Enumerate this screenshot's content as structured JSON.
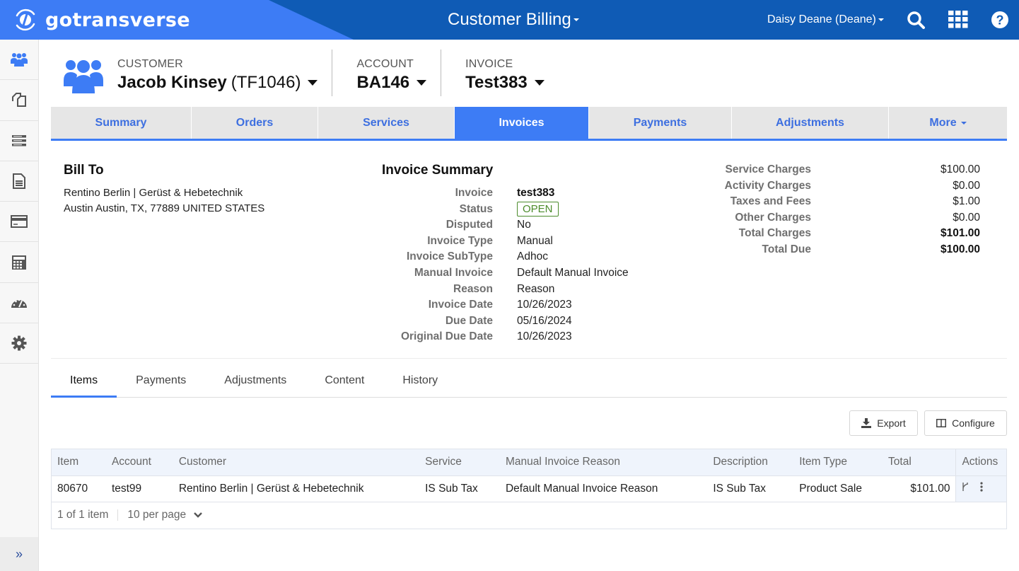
{
  "topbar": {
    "brand": "gotransverse",
    "app_title": "Customer Billing",
    "user": "Daisy Deane (Deane)",
    "icons": [
      "search-icon",
      "apps-grid-icon",
      "help-icon"
    ]
  },
  "sidebar": {
    "items": [
      {
        "name": "customers",
        "icon": "users-icon",
        "active": true
      },
      {
        "name": "documents",
        "icon": "copy-icon"
      },
      {
        "name": "services",
        "icon": "server-list-icon"
      },
      {
        "name": "invoices",
        "icon": "file-text-icon"
      },
      {
        "name": "payments",
        "icon": "credit-card-icon"
      },
      {
        "name": "calculator",
        "icon": "calculator-icon"
      },
      {
        "name": "dashboard",
        "icon": "gauge-icon"
      },
      {
        "name": "settings",
        "icon": "gear-icon"
      }
    ],
    "expand_icon": "»"
  },
  "context": {
    "customer_label": "CUSTOMER",
    "customer_name": "Jacob Kinsey",
    "customer_id": "(TF1046)",
    "account_label": "ACCOUNT",
    "account_value": "BA146",
    "invoice_label": "INVOICE",
    "invoice_value": "Test383"
  },
  "main_tabs": [
    {
      "label": "Summary"
    },
    {
      "label": "Orders"
    },
    {
      "label": "Services"
    },
    {
      "label": "Invoices",
      "active": true
    },
    {
      "label": "Payments"
    },
    {
      "label": "Adjustments"
    },
    {
      "label": "More"
    }
  ],
  "bill_to": {
    "title": "Bill To",
    "line1": "Rentino Berlin | Gerüst & Hebetechnik",
    "line2": "Austin Austin, TX, 77889 UNITED STATES"
  },
  "invoice_summary": {
    "title": "Invoice Summary",
    "fields": [
      {
        "k": "Invoice",
        "v": "test383"
      },
      {
        "k": "Status",
        "v": "OPEN"
      },
      {
        "k": "Disputed",
        "v": "No"
      },
      {
        "k": "Invoice Type",
        "v": "Manual"
      },
      {
        "k": "Invoice SubType",
        "v": "Adhoc"
      },
      {
        "k": "Manual Invoice",
        "v": "Default Manual Invoice"
      },
      {
        "k": "Reason",
        "v": "Reason"
      },
      {
        "k": "Invoice Date",
        "v": "10/26/2023"
      },
      {
        "k": "Due Date",
        "v": "05/16/2024"
      },
      {
        "k": "Original Due Date",
        "v": "10/26/2023"
      }
    ],
    "status_color": "#4c8c2c"
  },
  "totals": [
    {
      "k": "Service Charges",
      "v": "$100.00"
    },
    {
      "k": "Activity Charges",
      "v": "$0.00"
    },
    {
      "k": "Taxes and Fees",
      "v": "$1.00"
    },
    {
      "k": "Other Charges",
      "v": "$0.00"
    },
    {
      "k": "Total Charges",
      "v": "$101.00"
    },
    {
      "k": "Total Due",
      "v": "$100.00"
    }
  ],
  "sub_tabs": [
    {
      "label": "Items",
      "active": true
    },
    {
      "label": "Payments"
    },
    {
      "label": "Adjustments"
    },
    {
      "label": "Content"
    },
    {
      "label": "History"
    }
  ],
  "toolbar": {
    "export_label": "Export",
    "configure_label": "Configure"
  },
  "table": {
    "columns": [
      "Item",
      "Account",
      "Customer",
      "Service",
      "Manual Invoice Reason",
      "Description",
      "Item Type",
      "Total",
      "Actions"
    ],
    "rows": [
      {
        "item": "80670",
        "account": "test99",
        "customer": "Rentino Berlin | Gerüst & Hebetechnik",
        "service": "IS Sub Tax",
        "reason": "Default Manual Invoice Reason",
        "description": "IS Sub Tax",
        "item_type": "Product Sale",
        "total": "$101.00"
      }
    ],
    "pager_count": "1 of 1 item",
    "pager_size": "10 per page"
  },
  "colors": {
    "brand_blue": "#3d7cf5",
    "header_dark_blue": "#0f5bb5"
  }
}
